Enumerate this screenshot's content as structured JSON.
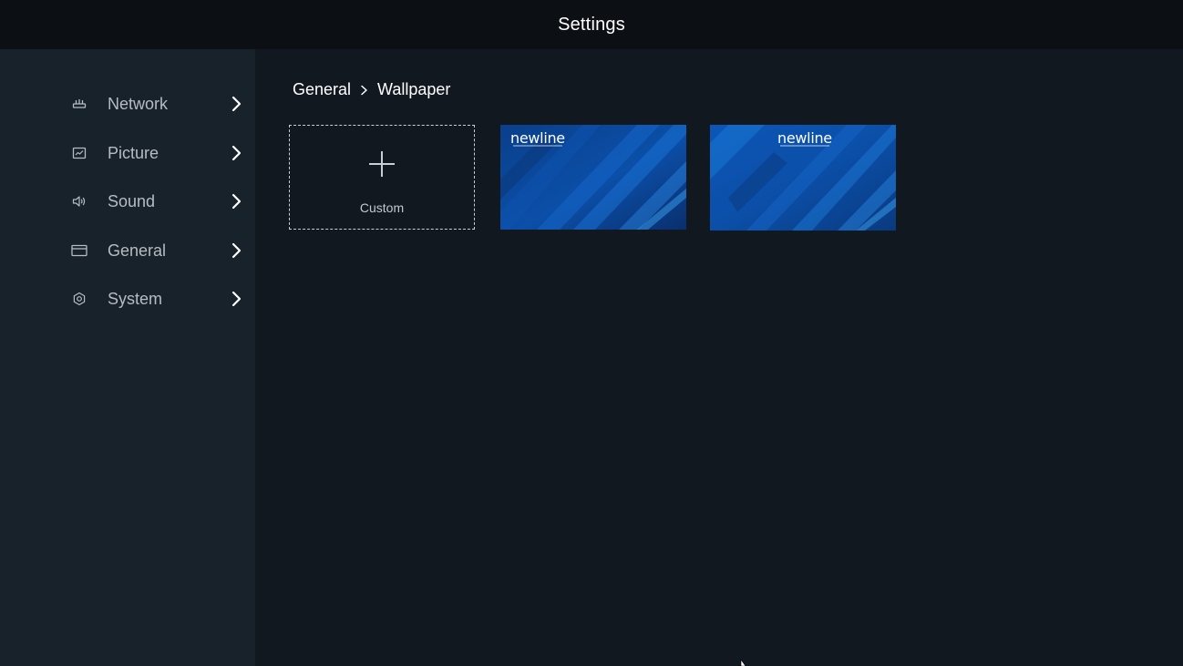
{
  "app": {
    "title": "Settings"
  },
  "sidebar": {
    "items": [
      {
        "label": "Network",
        "icon": "router-icon"
      },
      {
        "label": "Picture",
        "icon": "picture-icon"
      },
      {
        "label": "Sound",
        "icon": "speaker-icon"
      },
      {
        "label": "General",
        "icon": "window-icon"
      },
      {
        "label": "System",
        "icon": "gear-icon"
      }
    ]
  },
  "breadcrumb": {
    "parent": "General",
    "current": "Wallpaper"
  },
  "wallpapers": {
    "custom_label": "Custom",
    "items": [
      {
        "brand": "newline"
      },
      {
        "brand": "newline"
      }
    ]
  },
  "colors": {
    "topbar": "#0c0f13",
    "sidebar": "#17222b",
    "main": "#121820",
    "wallpaper_blue": "#0b4fa8"
  }
}
